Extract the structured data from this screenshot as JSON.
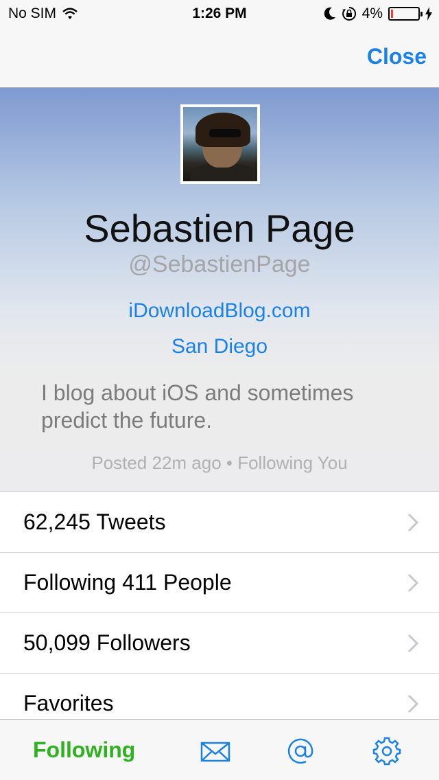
{
  "status_bar": {
    "carrier": "No SIM",
    "time": "1:26 PM",
    "battery": "4%",
    "battery_level": 0.04
  },
  "navbar": {
    "close_label": "Close"
  },
  "profile": {
    "name": "Sebastien Page",
    "handle": "@SebastienPage",
    "website": "iDownloadBlog.com",
    "location": "San Diego",
    "bio": "I blog about iOS and sometimes predict the future.",
    "meta": "Posted 22m ago • Following You"
  },
  "list": {
    "items": [
      {
        "label": "62,245 Tweets"
      },
      {
        "label": "Following 411 People"
      },
      {
        "label": "50,099 Followers"
      },
      {
        "label": "Favorites"
      }
    ]
  },
  "tabbar": {
    "following_label": "Following",
    "icons": [
      "envelope-icon",
      "at-icon",
      "gear-icon"
    ]
  },
  "colors": {
    "accent": "#1a82e6",
    "following_green": "#2fb21f",
    "battery_low": "#ff3b30"
  }
}
